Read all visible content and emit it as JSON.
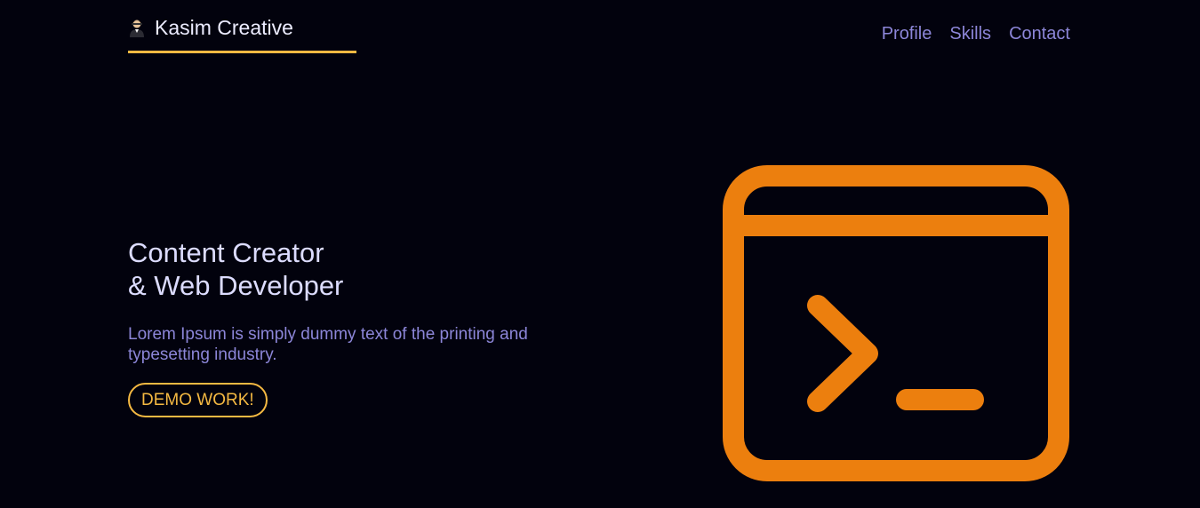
{
  "header": {
    "brand_name": "Kasim Creative",
    "brand_icon": "developer-avatar-icon",
    "nav": [
      {
        "label": "Profile"
      },
      {
        "label": "Skills"
      },
      {
        "label": "Contact"
      }
    ]
  },
  "hero": {
    "title_line1": "Content Creator",
    "title_line2": "& Web Developer",
    "description": "Lorem Ipsum is simply dummy text of the printing and typesetting industry.",
    "cta_label": "DEMO WORK!"
  },
  "illustration": {
    "icon": "terminal-window-icon"
  },
  "colors": {
    "background": "#02020d",
    "accent_yellow": "#f5b942",
    "accent_orange": "#ec7f0e",
    "nav_purple": "#8c86d8",
    "title_text": "#dcdcff"
  }
}
